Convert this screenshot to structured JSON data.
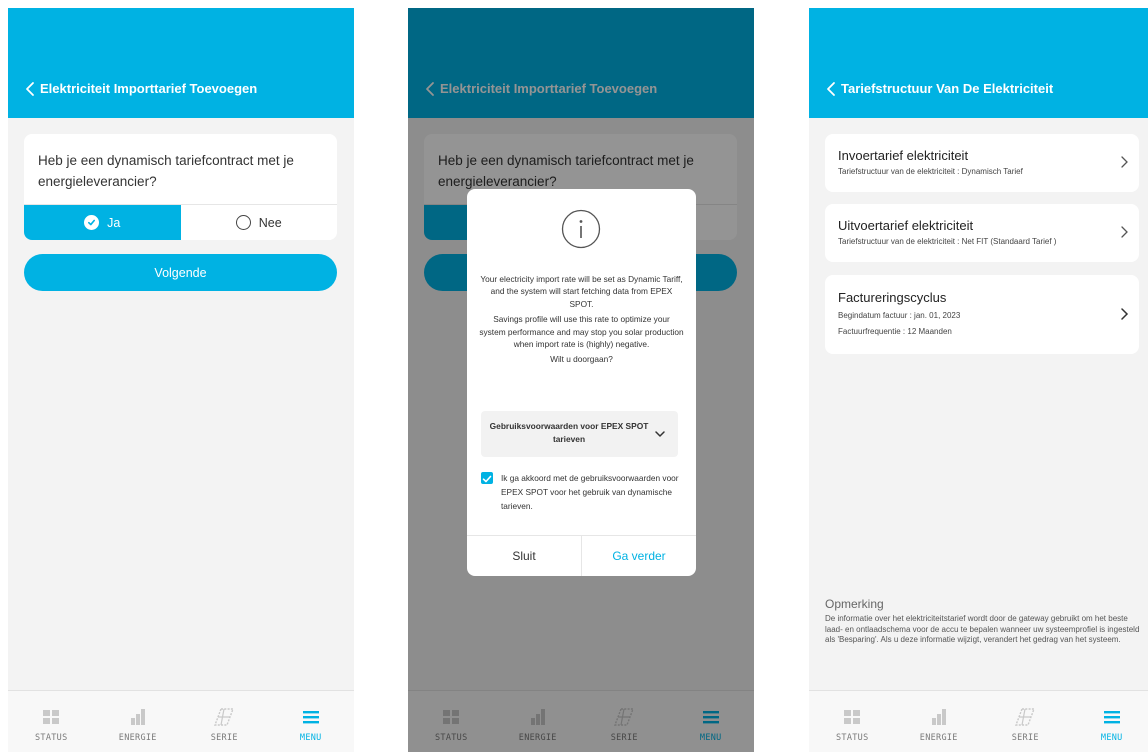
{
  "screen1": {
    "header_title": "Elektriciteit Importtarief Toevoegen",
    "question": "Heb je een dynamisch tariefcontract met je energieleverancier?",
    "option_yes": "Ja",
    "option_no": "Nee",
    "next_button": "Volgende"
  },
  "screen2": {
    "header_title": "Elektriciteit Importtarief Toevoegen",
    "question": "Heb je een dynamisch tariefcontract met je energieleverancier?",
    "dialog": {
      "para1": "Your electricity import rate will be set as Dynamic Tariff, and the system will start fetching data from EPEX SPOT.",
      "para2": "Savings profile will use this rate to optimize your system performance and may stop you solar production when import rate is (highly) negative.",
      "question": "Wilt u doorgaan?",
      "accordion_title": "Gebruiksvoorwaarden voor EPEX SPOT tarieven",
      "agree_text": "Ik ga akkoord met de gebruiksvoorwaarden voor EPEX SPOT voor het gebruik van dynamische tarieven.",
      "agree_checked": true,
      "cancel_button": "Sluit",
      "confirm_button": "Ga verder"
    }
  },
  "screen3": {
    "header_title": "Tariefstructuur Van De Elektriciteit",
    "cards": [
      {
        "title": "Invoertarief elektriciteit",
        "lines": [
          "Tariefstructuur van de elektriciteit  : Dynamisch Tarief"
        ]
      },
      {
        "title": "Uitvoertarief elektriciteit",
        "lines": [
          "Tariefstructuur van de elektriciteit  : Net FIT (Standaard Tarief )"
        ]
      },
      {
        "title": "Factureringscyclus",
        "lines": [
          "Begindatum factuur : jan. 01, 2023",
          "Factuurfrequentie    : 12 Maanden"
        ]
      }
    ],
    "note_title": "Opmerking",
    "note_body": "De informatie over het elektriciteitstarief wordt door de gateway gebruikt om het beste laad- en ontlaadschema voor de accu te bepalen wanneer uw systeemprofiel is ingesteld als 'Besparing'. Als u deze informatie wijzigt, verandert het gedrag van het systeem."
  },
  "nav": {
    "items": [
      {
        "label": "STATUS",
        "icon": "status-grid-icon"
      },
      {
        "label": "ENERGIE",
        "icon": "energy-bars-icon"
      },
      {
        "label": "SERIE",
        "icon": "solar-panel-icon"
      },
      {
        "label": "MENU",
        "icon": "menu-icon"
      }
    ],
    "active": "MENU"
  },
  "colors": {
    "accent": "#00b2e3",
    "background": "#f3f3f3",
    "nav_inactive": "#9a9a9a"
  }
}
